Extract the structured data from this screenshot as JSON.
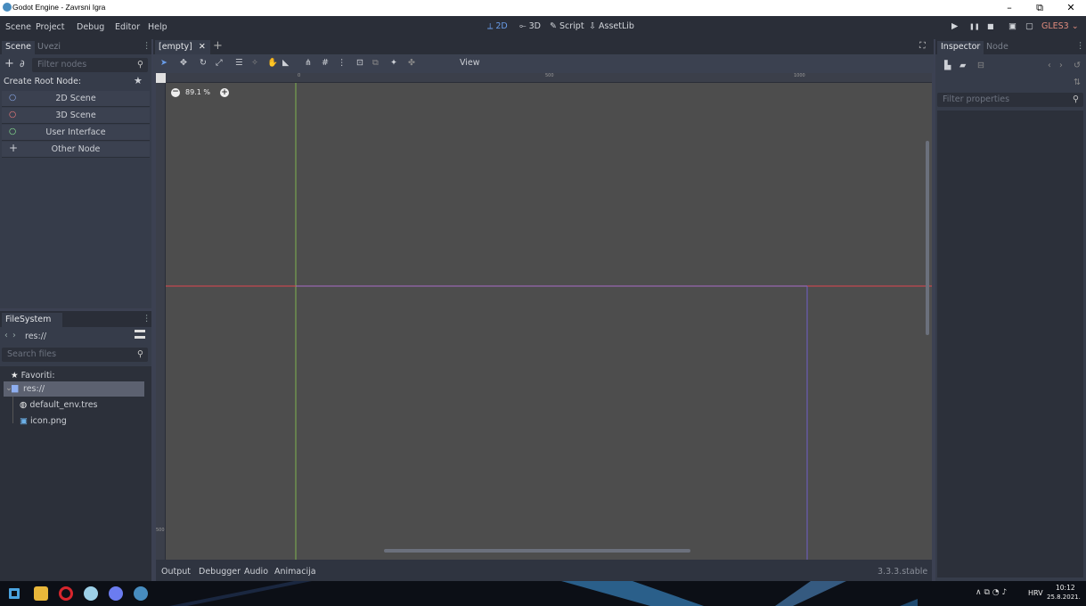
{
  "window": {
    "title": "Godot Engine - Zavrsni Igra",
    "minimize": "–",
    "maximize": "⧉",
    "close": "✕"
  },
  "menu": [
    "Scene",
    "Project",
    "Debug",
    "Editor",
    "Help"
  ],
  "workspaces": [
    {
      "icon": "⟂",
      "label": "2D"
    },
    {
      "icon": "⟜",
      "label": "3D"
    },
    {
      "icon": "✎",
      "label": "Script"
    },
    {
      "icon": "⇩",
      "label": "AssetLib"
    }
  ],
  "renderer": "GLES3",
  "play_controls": [
    "▶",
    "❚❚",
    "■",
    "▣",
    "▢"
  ],
  "scene_dock": {
    "tabs": [
      "Scene",
      "Uvezi"
    ],
    "filter_placeholder": "Filter nodes",
    "create_root_label": "Create Root Node:",
    "root_options": [
      {
        "label": "2D Scene",
        "icon": "○",
        "color": "#8eaef0"
      },
      {
        "label": "3D Scene",
        "icon": "○",
        "color": "#fc7f7f"
      },
      {
        "label": "User Interface",
        "icon": "○",
        "color": "#8eef97"
      },
      {
        "label": "Other Node",
        "icon": "+",
        "color": "#e0e0e0"
      }
    ]
  },
  "filesystem_dock": {
    "tab": "FileSystem",
    "path": "res://",
    "search_placeholder": "Search files",
    "items": [
      {
        "label": "Favoriti:",
        "icon": "★"
      },
      {
        "label": "res://",
        "icon": "▆"
      },
      {
        "label": "default_env.tres",
        "icon": "◍"
      },
      {
        "label": "icon.png",
        "icon": "▣"
      }
    ]
  },
  "scene_tab": {
    "label": "[empty]",
    "close": "✕",
    "add": "+"
  },
  "toolbar": {
    "view_label": "View"
  },
  "zoom": {
    "value": "89.1 %",
    "minus": "−",
    "plus": "+"
  },
  "rulers": {
    "top_labels": [
      "0",
      "500",
      "1000"
    ],
    "left_label": "500"
  },
  "bottom_panel": {
    "tabs": [
      "Output",
      "Debugger",
      "Audio",
      "Animacija"
    ],
    "version": "3.3.3.stable"
  },
  "inspector": {
    "tabs": [
      "Inspector",
      "Node"
    ],
    "filter_placeholder": "Filter properties"
  },
  "taskbar": {
    "lang": "HRV",
    "time": "10:12",
    "date": "25.8.2021."
  },
  "colors": {
    "accent": "#699ce8",
    "axis_x": "#e0454e",
    "axis_y": "#7fb34f",
    "viewport_bg": "#4d4d4d"
  }
}
